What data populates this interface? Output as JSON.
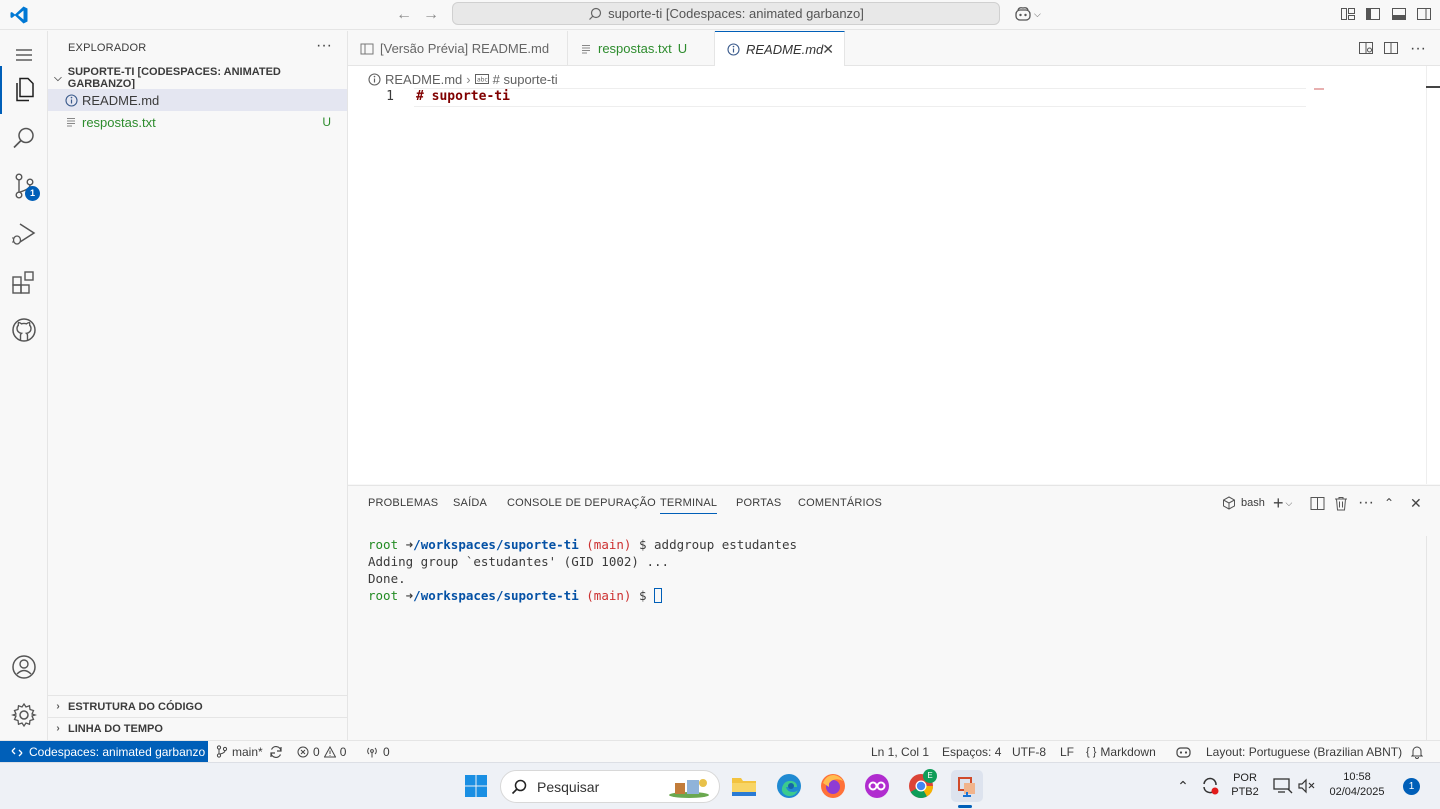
{
  "titlebar": {
    "search_text": "suporte-ti [Codespaces: animated garbanzo]"
  },
  "activity": {
    "scm_badge": "1"
  },
  "sidebar": {
    "title": "EXPLORADOR",
    "more": "···",
    "folder": "SUPORTE-TI [CODESPACES: ANIMATED GARBANZO]",
    "files": [
      {
        "name": "README.md",
        "status": ""
      },
      {
        "name": "respostas.txt",
        "status": "U"
      }
    ],
    "sections": [
      "ESTRUTURA DO CÓDIGO",
      "LINHA DO TEMPO"
    ]
  },
  "tabs": [
    {
      "label": "[Versão Prévia] README.md",
      "status": ""
    },
    {
      "label": "respostas.txt",
      "status": "U"
    },
    {
      "label": "README.md",
      "status": "",
      "close": "✕"
    }
  ],
  "editor": {
    "breadcrumb_file": "README.md",
    "breadcrumb_symbol": "# suporte-ti",
    "line_number": "1",
    "line_text": "# suporte-ti"
  },
  "panel": {
    "tabs": [
      "PROBLEMAS",
      "SAÍDA",
      "CONSOLE DE DEPURAÇÃO",
      "TERMINAL",
      "PORTAS",
      "COMENTÁRIOS"
    ],
    "active_tab": "TERMINAL",
    "shell": "bash"
  },
  "terminal": {
    "user": "root",
    "arrow": "➜",
    "path": "/workspaces/suporte-ti",
    "branch": "(main)",
    "command": "$ addgroup estudantes",
    "output1": "Adding group `estudantes' (GID 1002) ...",
    "output2": "Done.",
    "prompt_end": "$"
  },
  "statusbar": {
    "remote": "Codespaces: animated garbanzo",
    "branch": "main*",
    "errors": "0",
    "warnings": "0",
    "ports": "0",
    "position": "Ln 1, Col 1",
    "spaces": "Espaços: 4",
    "encoding": "UTF-8",
    "eol": "LF",
    "language": "Markdown",
    "layout": "Layout: Portuguese (Brazilian ABNT)"
  },
  "taskbar": {
    "search_placeholder": "Pesquisar",
    "lang_top": "POR",
    "lang_bottom": "PTB2",
    "time": "10:58",
    "date": "02/04/2025",
    "notifications": "1",
    "chrome_badge": "E"
  },
  "colors": {
    "accent": "#005fb8",
    "untracked": "#2d8c2d",
    "heading": "#800000"
  }
}
